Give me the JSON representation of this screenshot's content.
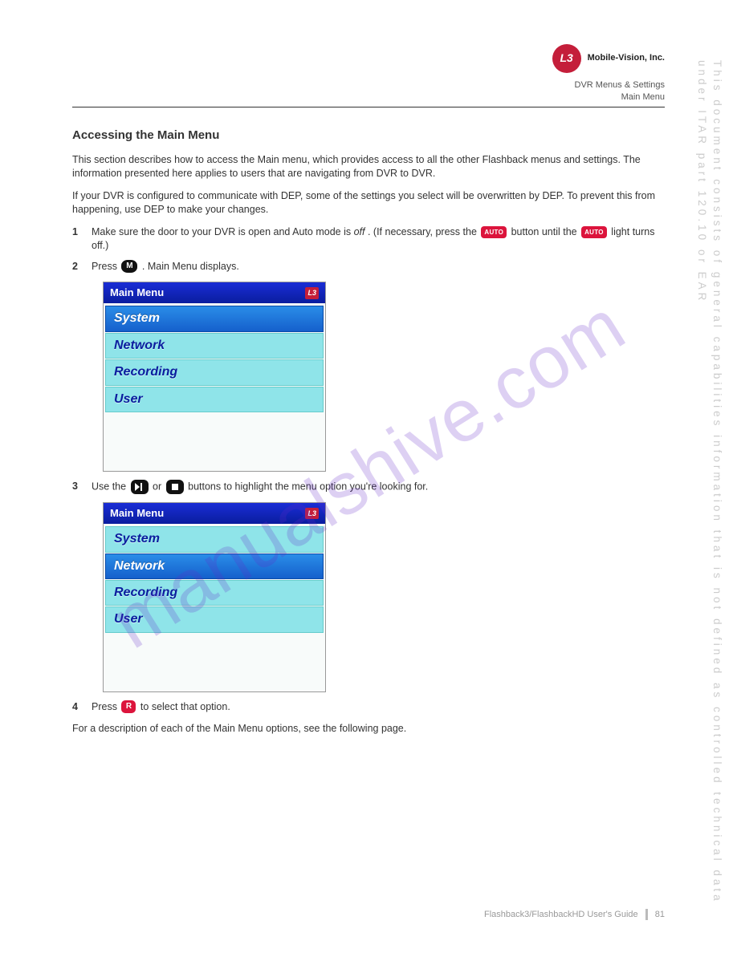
{
  "header": {
    "company": "Mobile-Vision, Inc.",
    "logo_abbrev": "L3"
  },
  "breadcrumb": {
    "line1": "DVR Menus & Settings",
    "line2": "Main Menu"
  },
  "section": {
    "title": "Accessing the Main Menu",
    "intro": "This section describes how to access the Main menu, which provides access to all the other Flashback menus and settings. The information presented here applies to users that are navigating from DVR to DVR.",
    "savenote_pre": "If your DVR is configured to communicate with DEP, some of the settings you select will be overwritten by DEP. To prevent this from happening, use DEP to make your changes.",
    "step1_pre": "Make sure the door to your DVR is open and Auto mode is ",
    "step1_off": "off",
    "step1_post": ". (If necessary, press the ",
    "step1_auto": "AUTO",
    "step1_mid": " button until the ",
    "step1_end": " light turns off.)",
    "step2_pre": "Press ",
    "step2_m": "M",
    "step2_post": ". Main Menu displays.",
    "step3_pre": "Use the ",
    "step3_or": " or ",
    "step3_post": " buttons to highlight the menu option you're looking for.",
    "step4_pre": "Press ",
    "step4_r": "R",
    "step4_post": " to select that option.",
    "closing": "For a description of each of the Main Menu options, see the following page."
  },
  "device1": {
    "title": "Main Menu",
    "items": [
      "System",
      "Network",
      "Recording",
      "User"
    ],
    "selected_index": 0
  },
  "device2": {
    "title": "Main Menu",
    "items": [
      "System",
      "Network",
      "Recording",
      "User"
    ],
    "selected_index": 1
  },
  "watermark": "manualshive.com",
  "side_disclaimer": "This document consists of general capabilities information that is not defined as controlled technical data under  ITAR part 120.10 or EAR",
  "footer": {
    "doc": "Flashback3/FlashbackHD User's Guide",
    "page": "81"
  }
}
